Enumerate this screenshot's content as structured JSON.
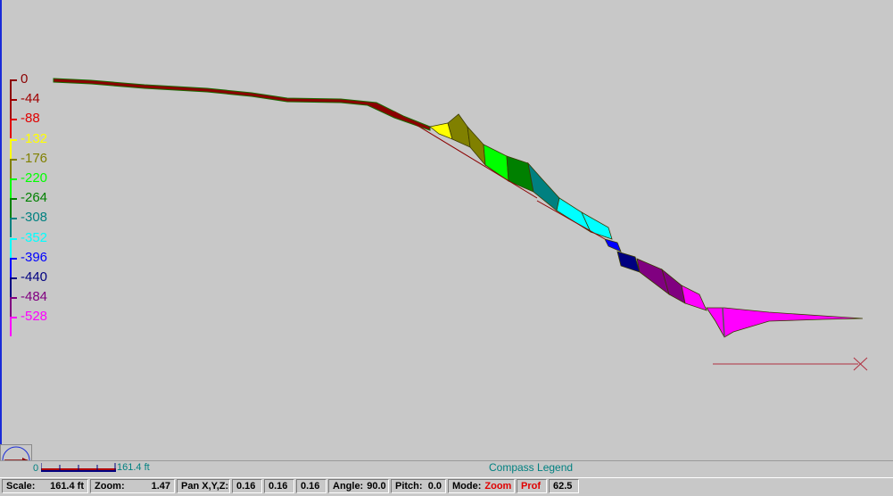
{
  "depth_legend": [
    {
      "label": "0",
      "color": "#8b0000"
    },
    {
      "label": "-44",
      "color": "#a00000"
    },
    {
      "label": "-88",
      "color": "#e00000"
    },
    {
      "label": "-132",
      "color": "#ffff00"
    },
    {
      "label": "-176",
      "color": "#808000"
    },
    {
      "label": "-220",
      "color": "#00ff00"
    },
    {
      "label": "-264",
      "color": "#008000"
    },
    {
      "label": "-308",
      "color": "#008080"
    },
    {
      "label": "-352",
      "color": "#00ffff"
    },
    {
      "label": "-396",
      "color": "#0000ff"
    },
    {
      "label": "-440",
      "color": "#000080"
    },
    {
      "label": "-484",
      "color": "#800080"
    },
    {
      "label": "-528",
      "color": "#ff00ff"
    }
  ],
  "scale_legend": {
    "zero": "0",
    "max": "161.4 ft"
  },
  "compass_legend_label": "Compass Legend",
  "status": {
    "scale_label": "Scale:",
    "scale_value": "161.4 ft",
    "zoom_label": "Zoom:",
    "zoom_value": "1.47",
    "pan_label": "Pan X,Y,Z:",
    "pan_x": "0.16",
    "pan_y": "0.16",
    "pan_z": "0.16",
    "angle_label": "Angle:",
    "angle_value": "90.0",
    "pitch_label": "Pitch:",
    "pitch_value": "0.0",
    "mode_label": "Mode:",
    "mode_value": "Zoom",
    "prof_label": "Prof",
    "fps_value": "62.5"
  }
}
